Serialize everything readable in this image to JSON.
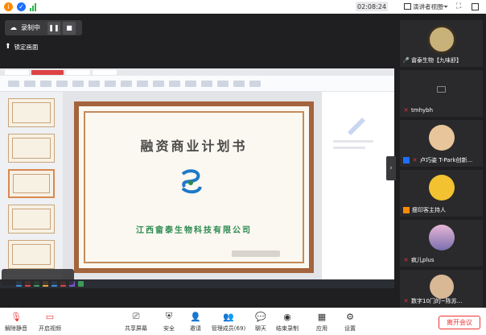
{
  "topbar": {
    "clock": "02:08:24",
    "view_label": "演讲者视图",
    "signal_colors": [
      "#ff8a00",
      "#1e6fff",
      "#2fb44a"
    ]
  },
  "stage": {
    "recording_label": "录制中",
    "lock_label": "锁定画面"
  },
  "certificate": {
    "title": "融资商业计划书",
    "company": "江西畲泰生物科技有限公司"
  },
  "participants": [
    {
      "name": "畲泰生物【九味舒】",
      "avatar": "emblem"
    },
    {
      "name": "tmhybh",
      "avatar": "camera-off"
    },
    {
      "name": "卢巧姿 T-Park创新...",
      "avatar": "photo"
    },
    {
      "name": "瘦印客主持人",
      "avatar": "logo"
    },
    {
      "name": "疯儿plus",
      "avatar": "photo"
    },
    {
      "name": "数字10门的~陈苏...",
      "avatar": "photo"
    }
  ],
  "toolbar": {
    "unmute": "解除静音",
    "video": "开启视频",
    "share": "共享屏幕",
    "security": "安全",
    "invite": "邀请",
    "members": "管理成员(69)",
    "chat": "聊天",
    "record": "结束录制",
    "apps": "应用",
    "settings": "设置",
    "leave": "离开会议"
  },
  "colors": {
    "accent_red": "#e33333",
    "stage_bg": "#1f1f21",
    "cert_border": "#a4643d",
    "company_green": "#2c8a4f"
  }
}
